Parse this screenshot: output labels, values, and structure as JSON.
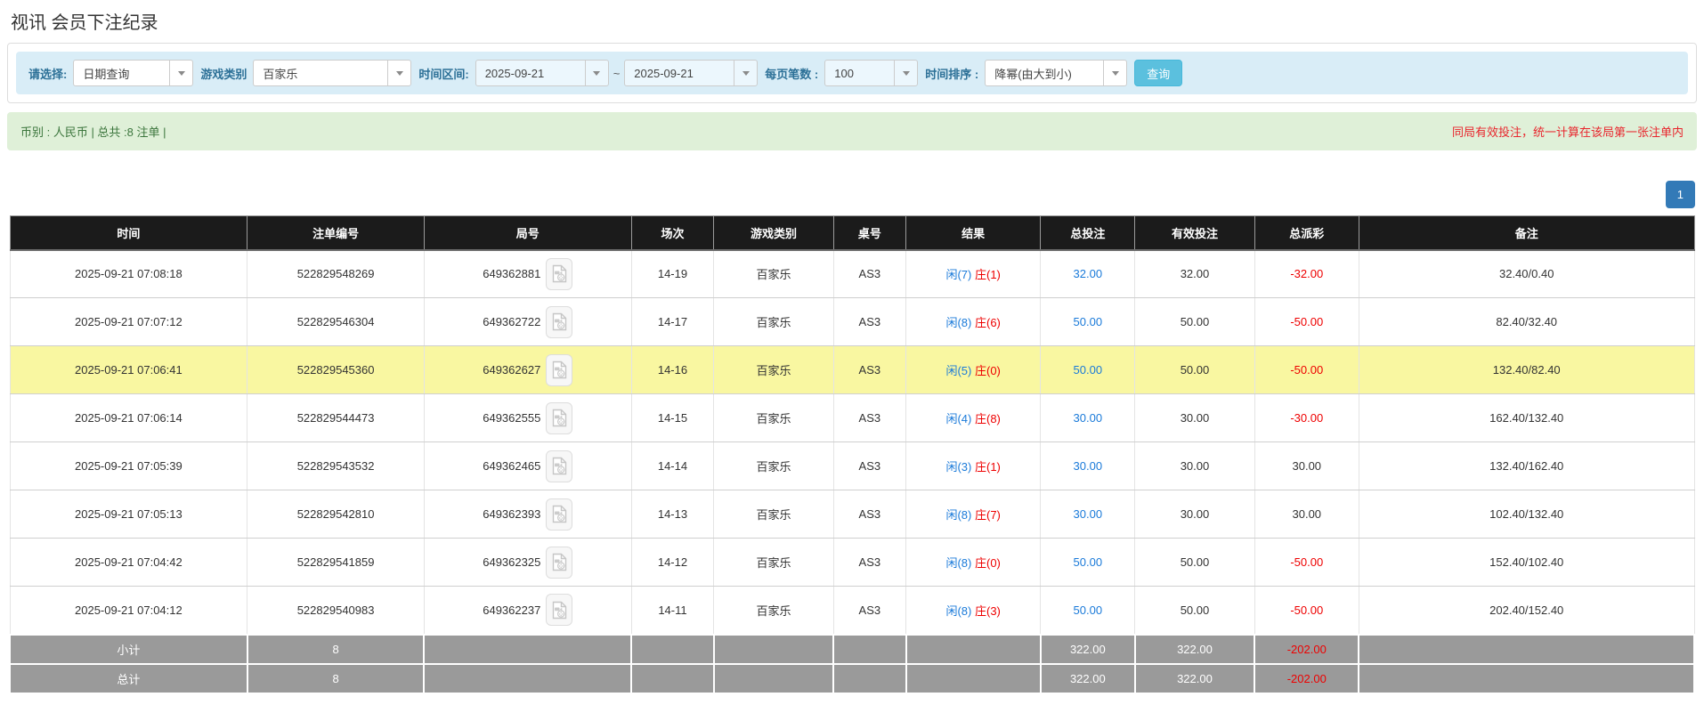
{
  "page": {
    "title": "视讯 会员下注纪录"
  },
  "filters": {
    "select_label": "请选择:",
    "select_value": "日期查询",
    "game_label": "游戏类别",
    "game_value": "百家乐",
    "range_label": "时间区间:",
    "date_from": "2025-09-21",
    "tilde": "~",
    "date_to": "2025-09-21",
    "page_size_label": "每页笔数 :",
    "page_size_value": "100",
    "sort_label": "时间排序 :",
    "sort_value": "降幂(由大到小)",
    "search_button": "查询"
  },
  "summary": {
    "left": "币别 : 人民币 | 总共 :8 注单 |",
    "right": "同局有效投注，统一计算在该局第一张注单内"
  },
  "pagination": {
    "current": "1"
  },
  "icons": {
    "video_icon": "video-file-icon",
    "caret_icon": "chevron-down-icon"
  },
  "colors": {
    "filter_bar_bg": "#d9edf7",
    "filter_label": "#2c7097",
    "search_button_bg": "#5bc0de",
    "summary_bg": "#dff0d8",
    "summary_text": "#3c763d",
    "notice_red": "#e8262d",
    "header_bg": "#1b1b1b",
    "highlight_row_bg": "#f9f7a1",
    "footer_bg": "#9a9a9a",
    "link_blue": "#1a7ad9",
    "negative_red": "#ee0000",
    "pager_blue": "#337ab7"
  },
  "table": {
    "headers": [
      "时间",
      "注单编号",
      "局号",
      "场次",
      "游戏类别",
      "桌号",
      "结果",
      "总投注",
      "有效投注",
      "总派彩",
      "备注"
    ],
    "rows": [
      {
        "time": "2025-09-21 07:08:18",
        "bet_id": "522829548269",
        "round": "649362881",
        "session": "14-19",
        "game": "百家乐",
        "table": "AS3",
        "result_player": "闲(7)",
        "result_banker": "庄(1)",
        "total_bet": "32.00",
        "valid_bet": "32.00",
        "payout": "-32.00",
        "note": "32.40/0.40",
        "highlighted": false
      },
      {
        "time": "2025-09-21 07:07:12",
        "bet_id": "522829546304",
        "round": "649362722",
        "session": "14-17",
        "game": "百家乐",
        "table": "AS3",
        "result_player": "闲(8)",
        "result_banker": "庄(6)",
        "total_bet": "50.00",
        "valid_bet": "50.00",
        "payout": "-50.00",
        "note": "82.40/32.40",
        "highlighted": false
      },
      {
        "time": "2025-09-21 07:06:41",
        "bet_id": "522829545360",
        "round": "649362627",
        "session": "14-16",
        "game": "百家乐",
        "table": "AS3",
        "result_player": "闲(5)",
        "result_banker": "庄(0)",
        "total_bet": "50.00",
        "valid_bet": "50.00",
        "payout": "-50.00",
        "note": "132.40/82.40",
        "highlighted": true
      },
      {
        "time": "2025-09-21 07:06:14",
        "bet_id": "522829544473",
        "round": "649362555",
        "session": "14-15",
        "game": "百家乐",
        "table": "AS3",
        "result_player": "闲(4)",
        "result_banker": "庄(8)",
        "total_bet": "30.00",
        "valid_bet": "30.00",
        "payout": "-30.00",
        "note": "162.40/132.40",
        "highlighted": false
      },
      {
        "time": "2025-09-21 07:05:39",
        "bet_id": "522829543532",
        "round": "649362465",
        "session": "14-14",
        "game": "百家乐",
        "table": "AS3",
        "result_player": "闲(3)",
        "result_banker": "庄(1)",
        "total_bet": "30.00",
        "valid_bet": "30.00",
        "payout": "30.00",
        "note": "132.40/162.40",
        "highlighted": false
      },
      {
        "time": "2025-09-21 07:05:13",
        "bet_id": "522829542810",
        "round": "649362393",
        "session": "14-13",
        "game": "百家乐",
        "table": "AS3",
        "result_player": "闲(8)",
        "result_banker": "庄(7)",
        "total_bet": "30.00",
        "valid_bet": "30.00",
        "payout": "30.00",
        "note": "102.40/132.40",
        "highlighted": false
      },
      {
        "time": "2025-09-21 07:04:42",
        "bet_id": "522829541859",
        "round": "649362325",
        "session": "14-12",
        "game": "百家乐",
        "table": "AS3",
        "result_player": "闲(8)",
        "result_banker": "庄(0)",
        "total_bet": "50.00",
        "valid_bet": "50.00",
        "payout": "-50.00",
        "note": "152.40/102.40",
        "highlighted": false
      },
      {
        "time": "2025-09-21 07:04:12",
        "bet_id": "522829540983",
        "round": "649362237",
        "session": "14-11",
        "game": "百家乐",
        "table": "AS3",
        "result_player": "闲(8)",
        "result_banker": "庄(3)",
        "total_bet": "50.00",
        "valid_bet": "50.00",
        "payout": "-50.00",
        "note": "202.40/152.40",
        "highlighted": false
      }
    ],
    "footer": [
      {
        "label": "小计",
        "count": "8",
        "total_bet": "322.00",
        "valid_bet": "322.00",
        "payout": "-202.00"
      },
      {
        "label": "总计",
        "count": "8",
        "total_bet": "322.00",
        "valid_bet": "322.00",
        "payout": "-202.00"
      }
    ]
  }
}
